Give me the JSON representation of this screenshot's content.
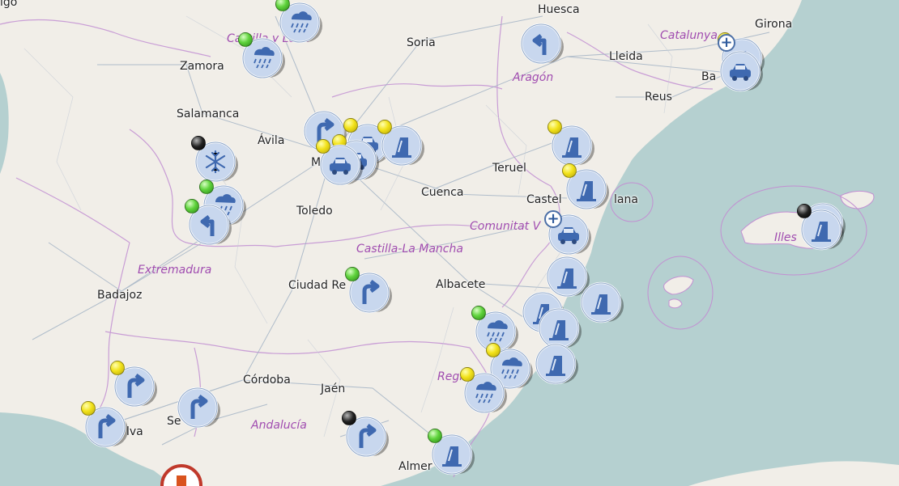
{
  "map": {
    "colors": {
      "land": "#f1eee8",
      "sea": "#b5d0d0",
      "region_border": "#c28fd2",
      "road": "#9fb0c3",
      "marker_fill": "#c8d7ee",
      "marker_symbol": "#3f69b0"
    },
    "cities": [
      {
        "key": "vigo",
        "label": "igo"
      },
      {
        "key": "huesca",
        "label": "Huesca"
      },
      {
        "key": "girona",
        "label": "Girona"
      },
      {
        "key": "zamora",
        "label": "Zamora"
      },
      {
        "key": "soria",
        "label": "Soria"
      },
      {
        "key": "lleida",
        "label": "Lleida"
      },
      {
        "key": "barcelona",
        "label": "Ba"
      },
      {
        "key": "reus",
        "label": "Reus"
      },
      {
        "key": "salamanca",
        "label": "Salamanca"
      },
      {
        "key": "avila",
        "label": "Ávila"
      },
      {
        "key": "madrid",
        "label": "M"
      },
      {
        "key": "teruel",
        "label": "Teruel"
      },
      {
        "key": "cuenca",
        "label": "Cuenca"
      },
      {
        "key": "toledo",
        "label": "Toledo"
      },
      {
        "key": "castellon",
        "label": "Castel"
      },
      {
        "key": "castellon2",
        "label": "lana"
      },
      {
        "key": "illes",
        "label": "Illes"
      },
      {
        "key": "badajoz",
        "label": "Badajoz"
      },
      {
        "key": "ciudadreal",
        "label": "Ciudad Re"
      },
      {
        "key": "albacete",
        "label": "Albacete"
      },
      {
        "key": "cordoba",
        "label": "Córdoba"
      },
      {
        "key": "jaen",
        "label": "Jaén"
      },
      {
        "key": "sevilla",
        "label": "Se"
      },
      {
        "key": "huelva",
        "label": "lva"
      },
      {
        "key": "almeria",
        "label": "Almer"
      }
    ],
    "regions": [
      {
        "key": "castilla_leon",
        "label": "Castilla y León"
      },
      {
        "key": "aragon",
        "label": "Aragón"
      },
      {
        "key": "catalunya",
        "label": "Catalunya"
      },
      {
        "key": "comunitat",
        "label": "Comunitat V"
      },
      {
        "key": "clm",
        "label": "Castilla-La Mancha"
      },
      {
        "key": "extremadura",
        "label": "Extremadura"
      },
      {
        "key": "murcia",
        "label": "Regi"
      },
      {
        "key": "andalucia",
        "label": "Andalucía"
      }
    ],
    "markers": [
      {
        "icon": "rain-icon",
        "status": "green"
      },
      {
        "icon": "rain-icon",
        "status": "green"
      },
      {
        "icon": "turn-left-icon",
        "status": ""
      },
      {
        "icon": "car-crash-icon",
        "status": "yellow"
      },
      {
        "icon": "car-crash-icon",
        "status": ""
      },
      {
        "icon": "turn-right-icon",
        "status": ""
      },
      {
        "icon": "car-crash-icon",
        "status": "yellow"
      },
      {
        "icon": "car-crash-icon",
        "status": "yellow"
      },
      {
        "icon": "car-crash-icon",
        "status": "yellow"
      },
      {
        "icon": "roadworks-icon",
        "status": "yellow"
      },
      {
        "icon": "snow-icon",
        "status": "black"
      },
      {
        "icon": "rain-icon",
        "status": "green"
      },
      {
        "icon": "turn-left-icon",
        "status": "green"
      },
      {
        "icon": "roadworks-icon",
        "status": "yellow"
      },
      {
        "icon": "roadworks-icon",
        "status": "yellow"
      },
      {
        "icon": "car-crash-icon",
        "status": ""
      },
      {
        "icon": "roadworks-icon",
        "status": ""
      },
      {
        "icon": "roadworks-icon",
        "status": ""
      },
      {
        "icon": "turn-right-icon",
        "status": "green"
      },
      {
        "icon": "roadworks-icon",
        "status": ""
      },
      {
        "icon": "roadworks-icon",
        "status": ""
      },
      {
        "icon": "roadworks-icon",
        "status": ""
      },
      {
        "icon": "rain-icon",
        "status": "green"
      },
      {
        "icon": "roadworks-icon",
        "status": ""
      },
      {
        "icon": "rain-icon",
        "status": "yellow"
      },
      {
        "icon": "rain-icon",
        "status": "yellow"
      },
      {
        "icon": "turn-right-icon",
        "status": "yellow"
      },
      {
        "icon": "turn-right-icon",
        "status": ""
      },
      {
        "icon": "turn-right-icon",
        "status": "yellow"
      },
      {
        "icon": "turn-right-icon",
        "status": "black"
      },
      {
        "icon": "roadworks-icon",
        "status": "green"
      },
      {
        "icon": "roadworks-icon",
        "status": "black"
      },
      {
        "icon": "warning-icon",
        "status": ""
      }
    ]
  }
}
